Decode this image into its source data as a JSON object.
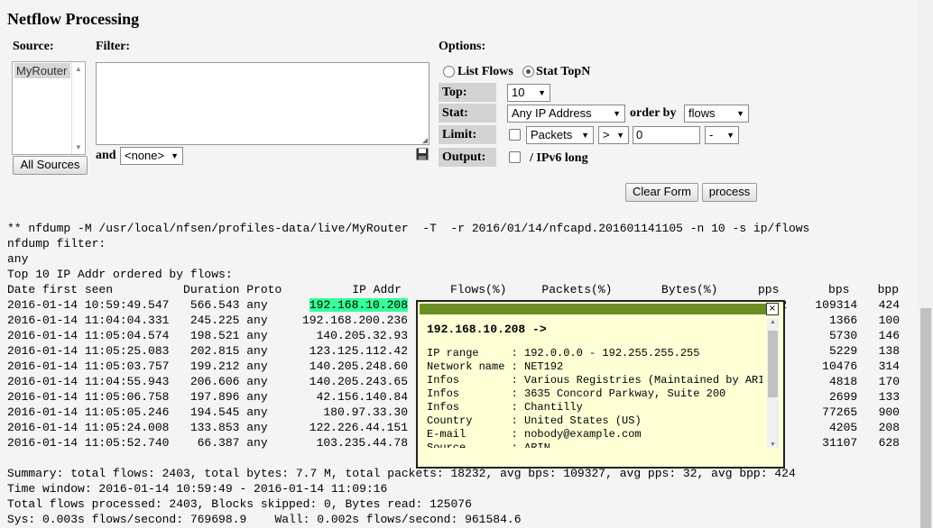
{
  "page": {
    "title": "Netflow Processing"
  },
  "source": {
    "label": "Source:",
    "items": [
      "MyRouter"
    ],
    "all_sources_label": "All Sources"
  },
  "filter": {
    "label": "Filter:",
    "and_label": "and",
    "and_select": "<none>"
  },
  "options": {
    "label": "Options:",
    "list_flows_label": "List Flows",
    "stat_topn_label": "Stat TopN",
    "top_label": "Top:",
    "top_value": "10",
    "stat_label": "Stat:",
    "stat_value": "Any IP Address",
    "order_by_label": "order by",
    "order_by_value": "flows",
    "limit_label": "Limit:",
    "limit_unit": "Packets",
    "limit_op": ">",
    "limit_value": "0",
    "limit_scale": "-",
    "output_label": "Output:",
    "ipv6_label": "/ IPv6 long"
  },
  "buttons": {
    "clear_form": "Clear Form",
    "process": "process"
  },
  "output": {
    "cmd": "** nfdump -M /usr/local/nfsen/profiles-data/live/MyRouter  -T  -r 2016/01/14/nfcapd.201601141105 -n 10 -s ip/flows",
    "filter_line": "nfdump filter:",
    "any_line": "any",
    "top_line": "Top 10 IP Addr ordered by flows:",
    "header_left": "Date first seen          Duration Proto          IP Addr",
    "header_mid": "     Flows(%)     Packets(%)       Bytes(%)",
    "header_right": "pps       bps    bpp",
    "rows": [
      {
        "left": "2016-01-14 10:59:49.547   566.543 any",
        "ip": "192.168.10.208",
        "right": "2    109314   424"
      },
      {
        "left": "2016-01-14 11:04:04.331   245.225 any",
        "ip": "192.168.200.236",
        "right": "1366   100"
      },
      {
        "left": "2016-01-14 11:05:04.574   198.521 any",
        "ip": "140.205.32.93",
        "right": "5730   146"
      },
      {
        "left": "2016-01-14 11:05:25.083   202.815 any",
        "ip": "123.125.112.42",
        "right": "5229   138"
      },
      {
        "left": "2016-01-14 11:05:03.757   199.212 any",
        "ip": "140.205.248.60",
        "right": "10476   314"
      },
      {
        "left": "2016-01-14 11:04:55.943   206.606 any",
        "ip": "140.205.243.65",
        "right": "4818   170"
      },
      {
        "left": "2016-01-14 11:05:06.758   197.896 any",
        "ip": "42.156.140.84",
        "right": "2699   133"
      },
      {
        "left": "2016-01-14 11:05:05.246   194.545 any",
        "ip": "180.97.33.30",
        "right": "77265   900"
      },
      {
        "left": "2016-01-14 11:05:24.008   133.853 any",
        "ip": "122.226.44.151",
        "right": "4205   208"
      },
      {
        "left": "2016-01-14 11:05:52.740    66.387 any",
        "ip": "103.235.44.78",
        "right": "31107   628"
      }
    ],
    "summary1": "Summary: total flows: 2403, total bytes: 7.7 M, total packets: 18232, avg bps: 109327, avg pps: 32, avg bpp: 424",
    "summary2": "Time window: 2016-01-14 10:59:49 - 2016-01-14 11:09:16",
    "summary3": "Total flows processed: 2403, Blocks skipped: 0, Bytes read: 125076",
    "summary4": "Sys: 0.003s flows/second: 769698.9    Wall: 0.002s flows/second: 961584.6"
  },
  "popup": {
    "title": "192.168.10.208 ->",
    "lines": [
      "IP range     : 192.0.0.0 - 192.255.255.255",
      "Network name : NET192",
      "Infos        : Various Registries (Maintained by ARIN)",
      "Infos        : 3635 Concord Parkway, Suite 200",
      "Infos        : Chantilly",
      "Country      : United States (US)",
      "E-mail       : nobody@example.com",
      "Source       : ARIN"
    ],
    "close": "×"
  },
  "colors": {
    "highlight": "#33ff99",
    "popup_bar": "#6b8e23",
    "popup_bg": "#ffffd6"
  }
}
